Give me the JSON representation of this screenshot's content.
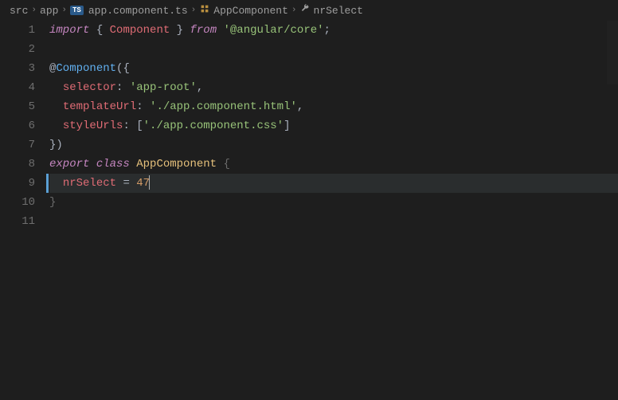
{
  "breadcrumb": {
    "items": [
      {
        "label": "src",
        "type": "folder"
      },
      {
        "label": "app",
        "type": "folder"
      },
      {
        "label": "app.component.ts",
        "type": "file",
        "badge": "TS"
      },
      {
        "label": "AppComponent",
        "type": "class"
      },
      {
        "label": "nrSelect",
        "type": "member"
      }
    ]
  },
  "editor": {
    "active_line": 9,
    "lines": [
      {
        "num": 1,
        "tokens": [
          {
            "t": "import",
            "c": "tok-keyword"
          },
          {
            "t": " ",
            "c": ""
          },
          {
            "t": "{",
            "c": "tok-punct"
          },
          {
            "t": " ",
            "c": ""
          },
          {
            "t": "Component",
            "c": "tok-import-name"
          },
          {
            "t": " ",
            "c": ""
          },
          {
            "t": "}",
            "c": "tok-punct"
          },
          {
            "t": " ",
            "c": ""
          },
          {
            "t": "from",
            "c": "tok-from"
          },
          {
            "t": " ",
            "c": ""
          },
          {
            "t": "'@angular/core'",
            "c": "tok-string"
          },
          {
            "t": ";",
            "c": "tok-punct"
          }
        ]
      },
      {
        "num": 2,
        "tokens": []
      },
      {
        "num": 3,
        "tokens": [
          {
            "t": "@",
            "c": "tok-decorator-at"
          },
          {
            "t": "Component",
            "c": "tok-decorator-name"
          },
          {
            "t": "(",
            "c": "tok-punct"
          },
          {
            "t": "{",
            "c": "tok-punct"
          }
        ]
      },
      {
        "num": 4,
        "tokens": [
          {
            "t": "  ",
            "c": ""
          },
          {
            "t": "selector",
            "c": "tok-prop"
          },
          {
            "t": ":",
            "c": "tok-punct"
          },
          {
            "t": " ",
            "c": ""
          },
          {
            "t": "'app-root'",
            "c": "tok-string"
          },
          {
            "t": ",",
            "c": "tok-punct"
          }
        ]
      },
      {
        "num": 5,
        "tokens": [
          {
            "t": "  ",
            "c": ""
          },
          {
            "t": "templateUrl",
            "c": "tok-prop"
          },
          {
            "t": ":",
            "c": "tok-punct"
          },
          {
            "t": " ",
            "c": ""
          },
          {
            "t": "'./app.component.html'",
            "c": "tok-string"
          },
          {
            "t": ",",
            "c": "tok-punct"
          }
        ]
      },
      {
        "num": 6,
        "tokens": [
          {
            "t": "  ",
            "c": ""
          },
          {
            "t": "styleUrls",
            "c": "tok-prop"
          },
          {
            "t": ":",
            "c": "tok-punct"
          },
          {
            "t": " ",
            "c": ""
          },
          {
            "t": "[",
            "c": "tok-punct"
          },
          {
            "t": "'./app.component.css'",
            "c": "tok-string"
          },
          {
            "t": "]",
            "c": "tok-punct"
          }
        ]
      },
      {
        "num": 7,
        "tokens": [
          {
            "t": "}",
            "c": "tok-punct"
          },
          {
            "t": ")",
            "c": "tok-punct"
          }
        ]
      },
      {
        "num": 8,
        "tokens": [
          {
            "t": "export",
            "c": "tok-keyword"
          },
          {
            "t": " ",
            "c": ""
          },
          {
            "t": "class",
            "c": "tok-class-kw"
          },
          {
            "t": " ",
            "c": ""
          },
          {
            "t": "AppComponent",
            "c": "tok-class-name"
          },
          {
            "t": " ",
            "c": ""
          },
          {
            "t": "{",
            "c": "tok-bracket-dim"
          }
        ]
      },
      {
        "num": 9,
        "tokens": [
          {
            "t": "  ",
            "c": ""
          },
          {
            "t": "nrSelect",
            "c": "tok-var"
          },
          {
            "t": " ",
            "c": ""
          },
          {
            "t": "=",
            "c": "tok-punct"
          },
          {
            "t": " ",
            "c": ""
          },
          {
            "t": "47",
            "c": "tok-number"
          }
        ],
        "cursor_after": true
      },
      {
        "num": 10,
        "tokens": [
          {
            "t": "}",
            "c": "tok-bracket-dim"
          }
        ]
      },
      {
        "num": 11,
        "tokens": []
      }
    ]
  }
}
